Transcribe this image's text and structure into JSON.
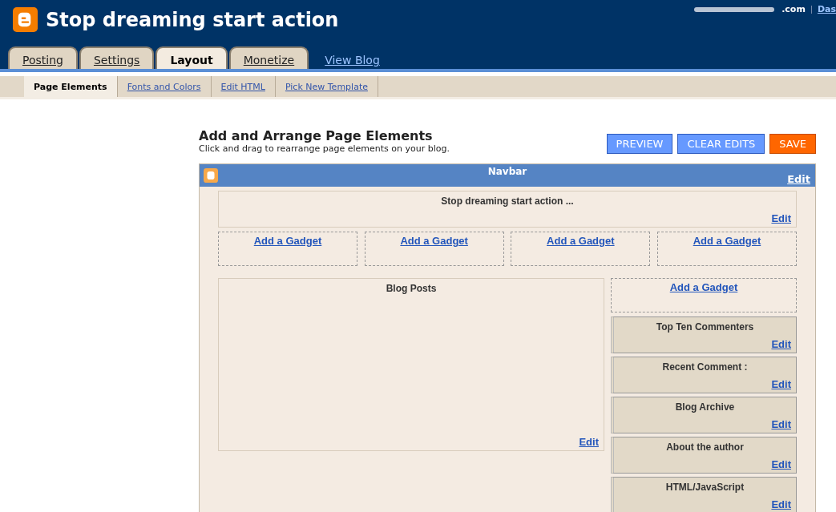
{
  "header": {
    "blog_title": "Stop dreaming start action",
    "account": ".com",
    "dashboard_link": "Das"
  },
  "tabs": [
    {
      "label": "Posting",
      "selected": false
    },
    {
      "label": "Settings",
      "selected": false
    },
    {
      "label": "Layout",
      "selected": true
    },
    {
      "label": "Monetize",
      "selected": false
    }
  ],
  "view_blog": "View Blog",
  "subtabs": [
    {
      "label": "Page Elements",
      "selected": true
    },
    {
      "label": "Fonts and Colors",
      "selected": false
    },
    {
      "label": "Edit HTML",
      "selected": false
    },
    {
      "label": "Pick New Template",
      "selected": false
    }
  ],
  "page": {
    "heading": "Add and Arrange Page Elements",
    "subheading": "Click and drag to rearrange page elements on your blog."
  },
  "buttons": [
    {
      "label": "PREVIEW",
      "kind": "secondary"
    },
    {
      "label": "CLEAR EDITS",
      "kind": "secondary"
    },
    {
      "label": "SAVE",
      "kind": "primary"
    }
  ],
  "navbar": {
    "title": "Navbar",
    "edit": "Edit"
  },
  "blog_header": {
    "title": "Stop dreaming start action ...",
    "edit": "Edit"
  },
  "header_gadgets": [
    "Add a Gadget",
    "Add a Gadget",
    "Add a Gadget",
    "Add a Gadget"
  ],
  "main": {
    "title": "Blog Posts",
    "edit": "Edit"
  },
  "sidebar": {
    "add_gadget": "Add a Gadget",
    "widgets": [
      {
        "title": "Top Ten Commenters",
        "edit": "Edit"
      },
      {
        "title": "Recent Comment :",
        "edit": "Edit"
      },
      {
        "title": "Blog Archive",
        "edit": "Edit"
      },
      {
        "title": "About the author",
        "edit": "Edit"
      },
      {
        "title": "HTML/JavaScript",
        "edit": "Edit"
      }
    ]
  }
}
